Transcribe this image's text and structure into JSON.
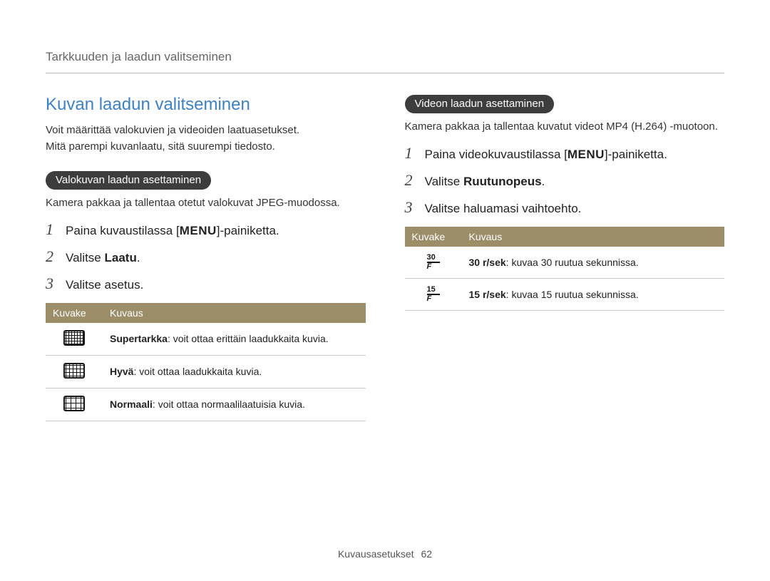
{
  "breadcrumb": "Tarkkuuden ja laadun valitseminen",
  "heading": "Kuvan laadun valitseminen",
  "intro": {
    "line1": "Voit määrittää valokuvien ja videoiden laatuasetukset.",
    "line2": "Mitä parempi kuvanlaatu, sitä suurempi tiedosto."
  },
  "photo": {
    "pill": "Valokuvan laadun asettaminen",
    "body": "Kamera pakkaa ja tallentaa otetut valokuvat JPEG-muodossa.",
    "steps": {
      "s1_pre": "Paina kuvaustilassa [",
      "s1_key": "MENU",
      "s1_post": "]-painiketta.",
      "s2_pre": "Valitse ",
      "s2_bold": "Laatu",
      "s2_post": ".",
      "s3": "Valitse asetus."
    },
    "table": {
      "h1": "Kuvake",
      "h2": "Kuvaus",
      "rows": [
        {
          "title": "Supertarkka",
          "desc": ": voit ottaa erittäin laadukkaita kuvia."
        },
        {
          "title": "Hyvä",
          "desc": ": voit ottaa laadukkaita kuvia."
        },
        {
          "title": "Normaali",
          "desc": ": voit ottaa normaalilaatuisia kuvia."
        }
      ]
    }
  },
  "video": {
    "pill": "Videon laadun asettaminen",
    "body": "Kamera pakkaa ja tallentaa kuvatut videot MP4 (H.264) -muotoon.",
    "steps": {
      "s1_pre": "Paina videokuvaustilassa [",
      "s1_key": "MENU",
      "s1_post": "]-painiketta.",
      "s2_pre": "Valitse ",
      "s2_bold": "Ruutunopeus",
      "s2_post": ".",
      "s3": "Valitse haluamasi vaihtoehto."
    },
    "table": {
      "h1": "Kuvake",
      "h2": "Kuvaus",
      "rows": [
        {
          "fps": "30",
          "title": "30 r/sek",
          "desc": ": kuvaa 30 ruutua sekunnissa."
        },
        {
          "fps": "15",
          "title": "15 r/sek",
          "desc": ": kuvaa 15 ruutua sekunnissa."
        }
      ]
    }
  },
  "footer": {
    "section": "Kuvausasetukset",
    "page": "62"
  }
}
